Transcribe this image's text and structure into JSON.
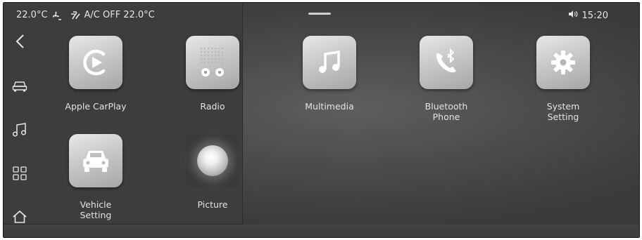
{
  "status_bar": {
    "cabin_temp": "22.0°C",
    "ac_status": "A/C OFF",
    "set_temp": "22.0°C",
    "time": "15:20",
    "icons": [
      "fan-icon",
      "airflow-icon",
      "volume-icon"
    ]
  },
  "sidebar": {
    "items": [
      {
        "name": "back",
        "icon": "chevron-left-icon"
      },
      {
        "name": "vehicle",
        "icon": "car-icon"
      },
      {
        "name": "music",
        "icon": "music-note-icon"
      },
      {
        "name": "apps",
        "icon": "grid-icon"
      },
      {
        "name": "home",
        "icon": "home-icon"
      }
    ]
  },
  "apps": [
    {
      "label": "Apple CarPlay",
      "icon": "carplay-icon"
    },
    {
      "label": "Radio",
      "icon": "radio-icon"
    },
    {
      "label": "Multimedia",
      "icon": "music-note-icon"
    },
    {
      "label": "Bluetooth\nPhone",
      "icon": "bluetooth-phone-icon"
    },
    {
      "label": "System\nSetting",
      "icon": "gear-icon"
    },
    {
      "label": "Vehicle\nSetting",
      "icon": "car-icon"
    },
    {
      "label": "Picture",
      "icon": "picture-icon"
    }
  ]
}
